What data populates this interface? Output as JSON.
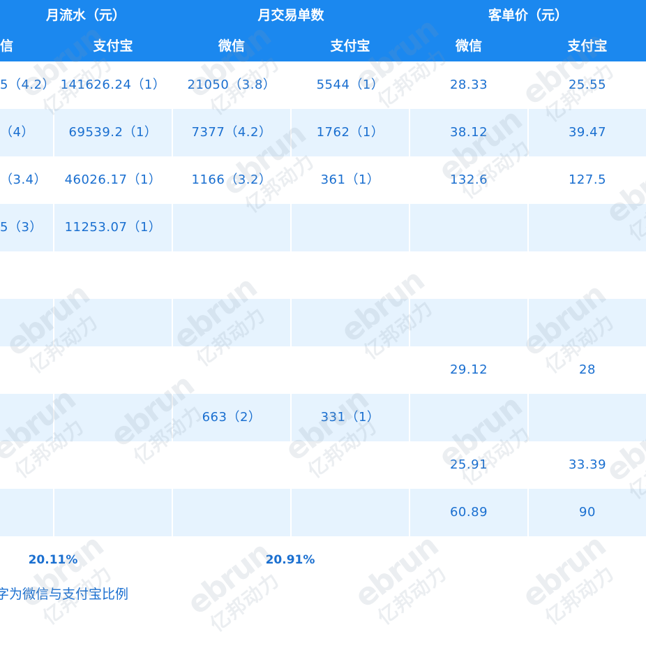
{
  "header": {
    "groups": [
      {
        "label": "月流水（元）"
      },
      {
        "label": "月交易单数"
      },
      {
        "label": "客单价（元）"
      }
    ],
    "subheaders": [
      "信",
      "支付宝",
      "微信",
      "支付宝",
      "微信",
      "支付宝"
    ]
  },
  "rows": [
    [
      "5（4.2）",
      "141626.24（1）",
      "21050（3.8）",
      "5544（1）",
      "28.33",
      "25.55"
    ],
    [
      "（4）",
      "69539.2（1）",
      "7377（4.2）",
      "1762（1）",
      "38.12",
      "39.47"
    ],
    [
      "（3.4）",
      "46026.17（1）",
      "1166（3.2）",
      "361（1）",
      "132.6",
      "127.5"
    ],
    [
      "5（3）",
      "11253.07（1）",
      "",
      "",
      "",
      ""
    ],
    [
      "",
      "",
      "",
      "",
      "",
      ""
    ],
    [
      "",
      "",
      "",
      "",
      "",
      ""
    ],
    [
      "",
      "",
      "",
      "",
      "29.12",
      "28"
    ],
    [
      "",
      "",
      "663（2）",
      "331（1）",
      "",
      ""
    ],
    [
      "",
      "",
      "",
      "",
      "25.91",
      "33.39"
    ],
    [
      "",
      "",
      "",
      "",
      "60.89",
      "90"
    ]
  ],
  "totals": {
    "revenue_pct": "20.11%",
    "orders_pct": "20.91%"
  },
  "footnote": "字为微信与支付宝比例",
  "watermark": {
    "line1": "ebrun",
    "line2": "亿邦动力"
  },
  "colors": {
    "header_bg": "#1b88ef",
    "row_alt_bg": "#e6f3fe",
    "text": "#1a6fd0"
  }
}
